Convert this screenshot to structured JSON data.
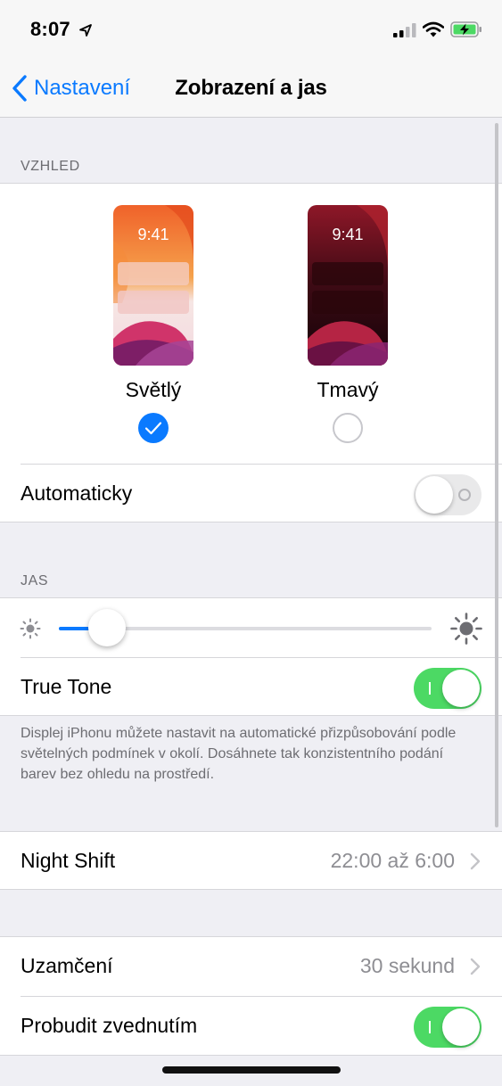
{
  "status": {
    "time": "8:07"
  },
  "nav": {
    "back_label": "Nastavení",
    "title": "Zobrazení a jas"
  },
  "appearance": {
    "header": "VZHLED",
    "options": [
      {
        "label": "Světlý",
        "preview_time": "9:41",
        "selected": true
      },
      {
        "label": "Tmavý",
        "preview_time": "9:41",
        "selected": false
      }
    ],
    "automatic": {
      "label": "Automaticky",
      "enabled": false
    }
  },
  "brightness": {
    "header": "JAS",
    "level": 0.13,
    "true_tone": {
      "label": "True Tone",
      "enabled": true
    },
    "footer": "Displej iPhonu můžete nastavit na automatické přizpůsobování podle světelných podmínek v okolí. Dosáhnete tak konzistentního podání barev bez ohledu na prostředí."
  },
  "night_shift": {
    "label": "Night Shift",
    "value": "22:00 až 6:00"
  },
  "lock": {
    "auto_lock": {
      "label": "Uzamčení",
      "value": "30 sekund"
    },
    "raise_to_wake": {
      "label": "Probudit zvednutím",
      "enabled": true
    }
  },
  "colors": {
    "accent": "#0a7aff",
    "toggle_on": "#4cd964",
    "background": "#efeff4"
  }
}
